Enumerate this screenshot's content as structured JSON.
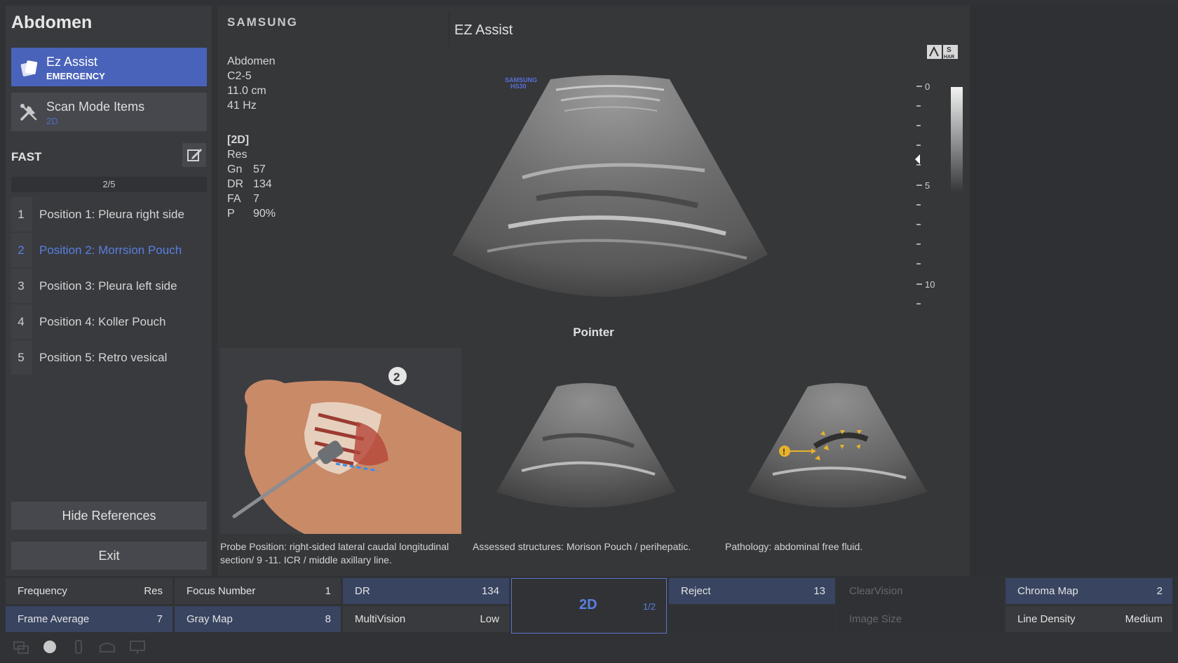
{
  "left_panel": {
    "preset_title": "Abdomen",
    "ez_assist": {
      "label": "Ez Assist",
      "sublabel": "EMERGENCY"
    },
    "scan_mode": {
      "label": "Scan Mode Items",
      "sublabel": "2D"
    },
    "protocol_title": "FAST",
    "page_indicator": "2/5",
    "positions": [
      {
        "num": "1",
        "label": "Position 1: Pleura right side"
      },
      {
        "num": "2",
        "label": "Position 2: Morrsion Pouch"
      },
      {
        "num": "3",
        "label": "Position 3: Pleura left side"
      },
      {
        "num": "4",
        "label": "Position 4: Koller Pouch"
      },
      {
        "num": "5",
        "label": "Position 5: Retro vesical"
      }
    ],
    "hide_references": "Hide References",
    "exit": "Exit"
  },
  "main": {
    "brand": "SAMSUNG",
    "title": "EZ Assist",
    "scan_info": {
      "preset": "Abdomen",
      "probe": "C2-5",
      "depth": "11.0 cm",
      "frame_rate": "41 Hz"
    },
    "mode_params": {
      "header": "[2D]",
      "res": "Res",
      "rows": [
        {
          "k": "Gn",
          "v": "57"
        },
        {
          "k": "DR",
          "v": "134"
        },
        {
          "k": "FA",
          "v": "7"
        },
        {
          "k": "P",
          "v": "90%"
        }
      ]
    },
    "image_watermark": {
      "line1": "SAMSUNG",
      "line2": "HS30"
    },
    "top_icon_labels": {
      "s": "S",
      "har": "HAR"
    },
    "depth_scale": [
      "0",
      "5",
      "10"
    ],
    "pointer_label": "Pointer",
    "references": [
      {
        "badge": "2",
        "caption": "Probe Position: right-sided lateral caudal longitudinal section/ 9 -11. ICR / middle axillary line."
      },
      {
        "caption": "Assessed structures: Morison Pouch / perihepatic."
      },
      {
        "caption": "Pathology: abdominal free fluid."
      }
    ]
  },
  "controls": {
    "frequency": {
      "name": "Frequency",
      "value": "Res"
    },
    "focus_number": {
      "name": "Focus Number",
      "value": "1"
    },
    "dr": {
      "name": "DR",
      "value": "134"
    },
    "reject": {
      "name": "Reject",
      "value": "13"
    },
    "clearvision": {
      "name": "ClearVision"
    },
    "chroma_map": {
      "name": "Chroma Map",
      "value": "2"
    },
    "frame_average": {
      "name": "Frame Average",
      "value": "7"
    },
    "gray_map": {
      "name": "Gray Map",
      "value": "8"
    },
    "multivision": {
      "name": "MultiVision",
      "value": "Low"
    },
    "image_size": {
      "name": "Image Size"
    },
    "line_density": {
      "name": "Line Density",
      "value": "Medium"
    },
    "center_mode": {
      "label": "2D",
      "page": "1/2"
    }
  },
  "colors": {
    "accent": "#5b7fe0",
    "active_button": "#4a63ba",
    "marker": "#e8b22a"
  }
}
